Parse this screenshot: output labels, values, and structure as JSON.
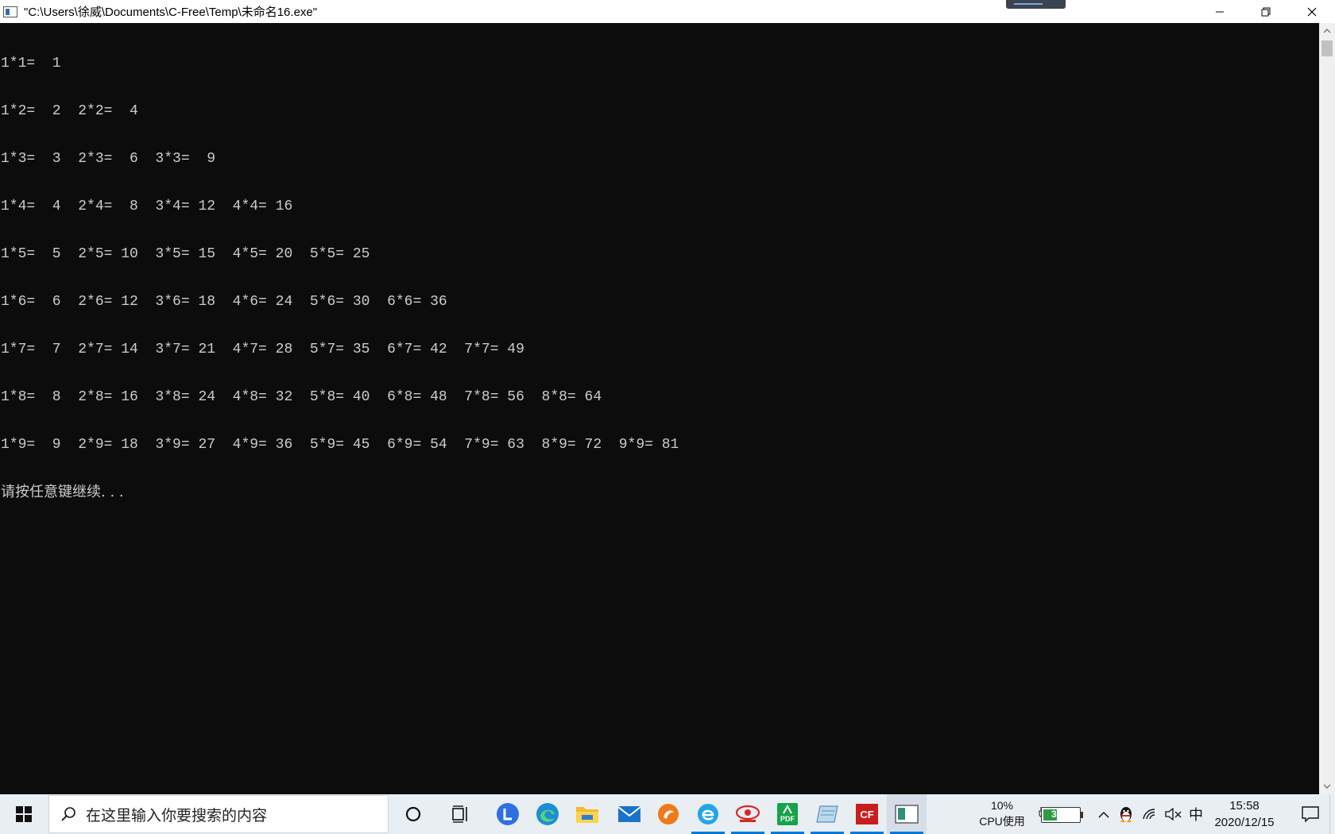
{
  "window": {
    "title": "\"C:\\Users\\徐威\\Documents\\C-Free\\Temp\\未命名16.exe\"",
    "minimize_icon": "minimize-icon",
    "maximize_icon": "restore-icon",
    "close_icon": "close-icon"
  },
  "console": {
    "lines": [
      "1*1=  1",
      "1*2=  2  2*2=  4",
      "1*3=  3  2*3=  6  3*3=  9",
      "1*4=  4  2*4=  8  3*4= 12  4*4= 16",
      "1*5=  5  2*5= 10  3*5= 15  4*5= 20  5*5= 25",
      "1*6=  6  2*6= 12  3*6= 18  4*6= 24  5*6= 30  6*6= 36",
      "1*7=  7  2*7= 14  3*7= 21  4*7= 28  5*7= 35  6*7= 42  7*7= 49",
      "1*8=  8  2*8= 16  3*8= 24  4*8= 32  5*8= 40  6*8= 48  7*8= 56  8*8= 64",
      "1*9=  9  2*9= 18  3*9= 27  4*9= 36  5*9= 45  6*9= 54  7*9= 63  8*9= 72  9*9= 81"
    ],
    "prompt": "请按任意键继续. . .",
    "text_color": "#cccccc",
    "background_color": "#0c0c0c"
  },
  "taskbar": {
    "search_placeholder": "在这里输入你要搜索的内容",
    "apps": [
      {
        "name": "cortana-icon"
      },
      {
        "name": "task-view-icon"
      },
      {
        "name": "lanxin-app-icon"
      },
      {
        "name": "edge-browser-icon"
      },
      {
        "name": "file-explorer-icon"
      },
      {
        "name": "mail-icon"
      },
      {
        "name": "orange-app-icon"
      },
      {
        "name": "blue-e-browser-icon"
      },
      {
        "name": "red-eye-app-icon"
      },
      {
        "name": "pdf-app-icon",
        "label": "PDF"
      },
      {
        "name": "notepad-app-icon"
      },
      {
        "name": "c-free-icon",
        "label": "CF"
      },
      {
        "name": "console-window-icon"
      }
    ],
    "cpu_percent": "10%",
    "cpu_label": "CPU使用",
    "battery_percent": "39%",
    "battery_level": 0.39,
    "ime": "中",
    "time": "15:58",
    "date": "2020/12/15",
    "accent_color": "#0078d7"
  }
}
